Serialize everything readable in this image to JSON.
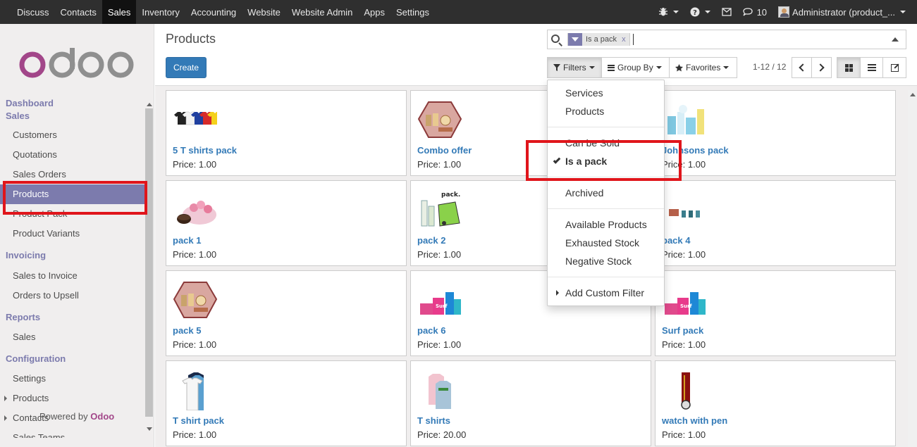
{
  "topbar": {
    "menu": [
      "Discuss",
      "Contacts",
      "Sales",
      "Inventory",
      "Accounting",
      "Website",
      "Website Admin",
      "Apps",
      "Settings"
    ],
    "active_menu": "Sales",
    "message_count": "10",
    "user": "Administrator (product_..."
  },
  "sidebar": {
    "logo_text": "odoo",
    "sections": {
      "dashboard": "Dashboard",
      "sales": "Sales",
      "invoicing": "Invoicing",
      "reports": "Reports",
      "configuration": "Configuration"
    },
    "sales_items": [
      "Customers",
      "Quotations",
      "Sales Orders",
      "Products",
      "Product Pack",
      "Product Variants"
    ],
    "invoicing_items": [
      "Sales to Invoice",
      "Orders to Upsell"
    ],
    "reports_items": [
      "Sales"
    ],
    "config_items": [
      "Settings",
      "Products",
      "Contacts",
      "Sales Teams"
    ],
    "powered_prefix": "Powered by",
    "powered_brand": "Odoo"
  },
  "control": {
    "title": "Products",
    "create_label": "Create",
    "facet_label": "Is a pack",
    "facet_close": "x",
    "filters_label": "Filters",
    "groupby_label": "Group By",
    "favorites_label": "Favorites",
    "pager": "1-12 / 12"
  },
  "filters_menu": {
    "items": [
      "Services",
      "Products",
      "Can be Sold",
      "Is a pack",
      "Archived",
      "Available Products",
      "Exhausted Stock",
      "Negative Stock",
      "Add Custom Filter"
    ],
    "checked": "Is a pack"
  },
  "products": [
    {
      "name": "5 T shirts pack",
      "price": "Price: 1.00"
    },
    {
      "name": "Combo offer",
      "price": "Price: 1.00"
    },
    {
      "name": "Johnsons pack",
      "price": "Price: 1.00"
    },
    {
      "name": "pack 1",
      "price": "Price: 1.00"
    },
    {
      "name": "pack 2",
      "price": "Price: 1.00"
    },
    {
      "name": "pack 4",
      "price": "Price: 1.00"
    },
    {
      "name": "pack 5",
      "price": "Price: 1.00"
    },
    {
      "name": "pack 6",
      "price": "Price: 1.00"
    },
    {
      "name": "Surf pack",
      "price": "Price: 1.00"
    },
    {
      "name": "T shirt pack",
      "price": "Price: 1.00"
    },
    {
      "name": "T shirts",
      "price": "Price: 20.00"
    },
    {
      "name": "watch with pen",
      "price": "Price: 1.00"
    }
  ],
  "colors": {
    "topbar": "#2f2f2f",
    "accent": "#7c7bad",
    "link": "#337ab7",
    "highlight": "#e0151b"
  }
}
